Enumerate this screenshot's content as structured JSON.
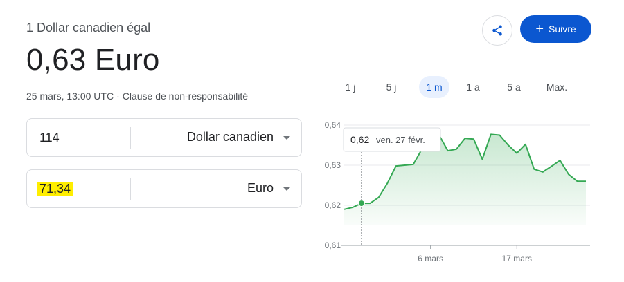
{
  "header": {
    "subtitle": "1 Dollar canadien égal",
    "rate": "0,63 Euro",
    "timestamp": "25 mars, 13:00 UTC",
    "separator": "·",
    "disclaimer": "Clause de non-responsabilité"
  },
  "actions": {
    "share_icon": "share-icon",
    "follow_label": "Suivre",
    "follow_color": "#0b57d0"
  },
  "converter": {
    "from_amount": "114",
    "from_currency": "Dollar canadien",
    "to_amount": "71,34",
    "to_currency": "Euro",
    "highlight_color": "#ffee00"
  },
  "ranges": {
    "tabs": [
      "1 j",
      "5 j",
      "1 m",
      "1 a",
      "5 a",
      "Max."
    ],
    "active": "1 m"
  },
  "chart_data": {
    "type": "area",
    "line_color": "#34a853",
    "y_ticks": [
      "0,64",
      "0,63",
      "0,62",
      "0,61"
    ],
    "y_tick_values": [
      0.64,
      0.63,
      0.62,
      0.61
    ],
    "ylim": [
      0.61,
      0.64
    ],
    "x_ticks": [
      "6 mars",
      "17 mars"
    ],
    "x_tick_index": [
      10,
      20
    ],
    "grid": true,
    "values": [
      0.619,
      0.6195,
      0.6205,
      0.6205,
      0.622,
      0.6255,
      0.6298,
      0.63,
      0.6302,
      0.634,
      0.6385,
      0.6375,
      0.6336,
      0.634,
      0.6367,
      0.6365,
      0.6315,
      0.6377,
      0.6375,
      0.635,
      0.633,
      0.6352,
      0.629,
      0.6283,
      0.6297,
      0.6312,
      0.6277,
      0.626,
      0.626
    ],
    "tooltip": {
      "index": 2,
      "value": "0,62",
      "date": "ven. 27 févr."
    }
  }
}
